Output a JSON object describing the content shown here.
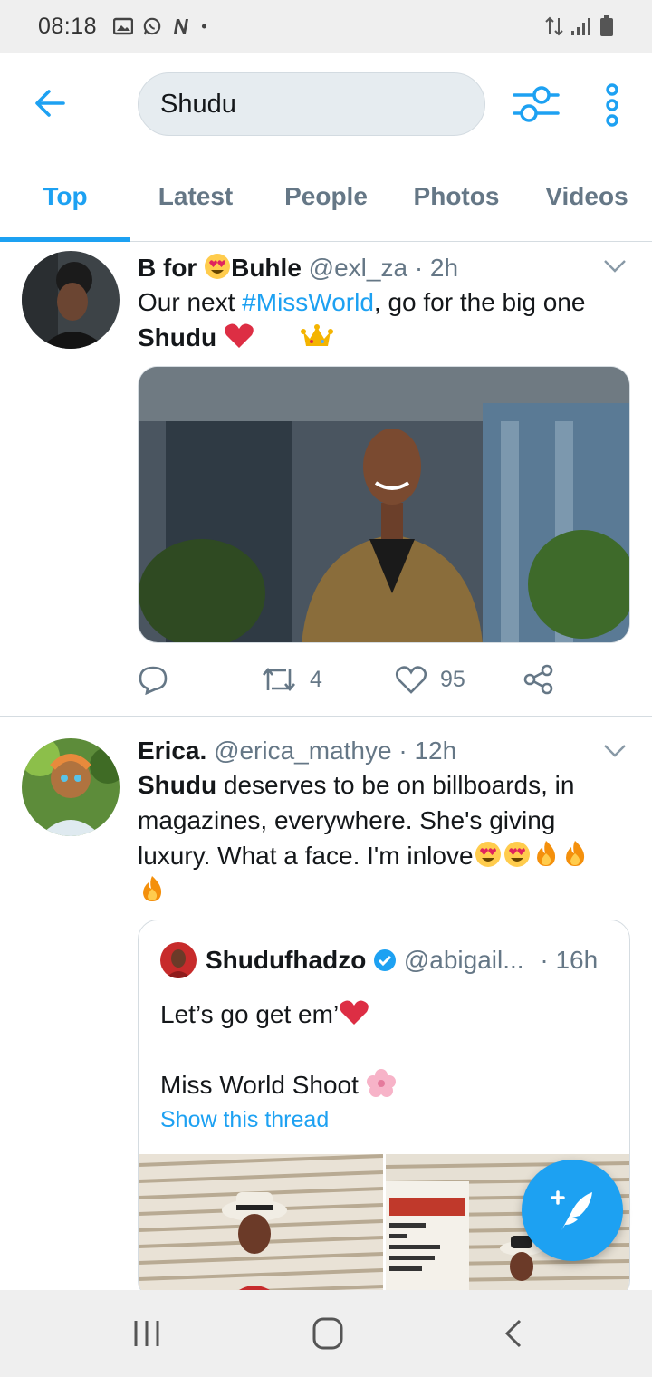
{
  "status_bar": {
    "time": "08:18",
    "left_icons": [
      "gallery-icon",
      "whatsapp-icon",
      "notification-n-icon",
      "dot-icon"
    ],
    "right_icons": [
      "data-arrows-icon",
      "signal-icon",
      "battery-icon"
    ]
  },
  "header": {
    "search_value": "Shudu",
    "back_icon": "back-arrow-icon",
    "filter_icon": "filter-sliders-icon",
    "more_icon": "more-vertical-icon"
  },
  "tabs": [
    {
      "label": "Top",
      "active": true
    },
    {
      "label": "Latest",
      "active": false
    },
    {
      "label": "People",
      "active": false
    },
    {
      "label": "Photos",
      "active": false
    },
    {
      "label": "Videos",
      "active": false
    }
  ],
  "tweets": [
    {
      "name_prefix": "B for ",
      "name_suffix": "Buhle",
      "handle": "@exl_za",
      "time": " · 2h",
      "text_before": "Our next ",
      "hashtag": "#MissWorld",
      "text_after": ", go for the big one",
      "line2_bold": "Shudu",
      "actions": {
        "retweets": "4",
        "likes": "95"
      }
    },
    {
      "name": "Erica.",
      "handle": "@erica_mathye",
      "time": " · 12h",
      "bold": "Shudu",
      "line1_rest": " deserves to be on billboards, in",
      "line2": "magazines, everywhere. She's giving",
      "line3": "luxury. What a face. I'm inlove",
      "quote": {
        "name": "Shudufhadzo",
        "handle": "@abigail...",
        "time": "· 16h",
        "line1": "Let’s go get em’",
        "line2": "Miss World Shoot",
        "link": "Show this thread"
      }
    }
  ],
  "colors": {
    "accent": "#1da1f2",
    "text": "#14171a",
    "muted": "#657786",
    "border": "#d5dce1"
  }
}
